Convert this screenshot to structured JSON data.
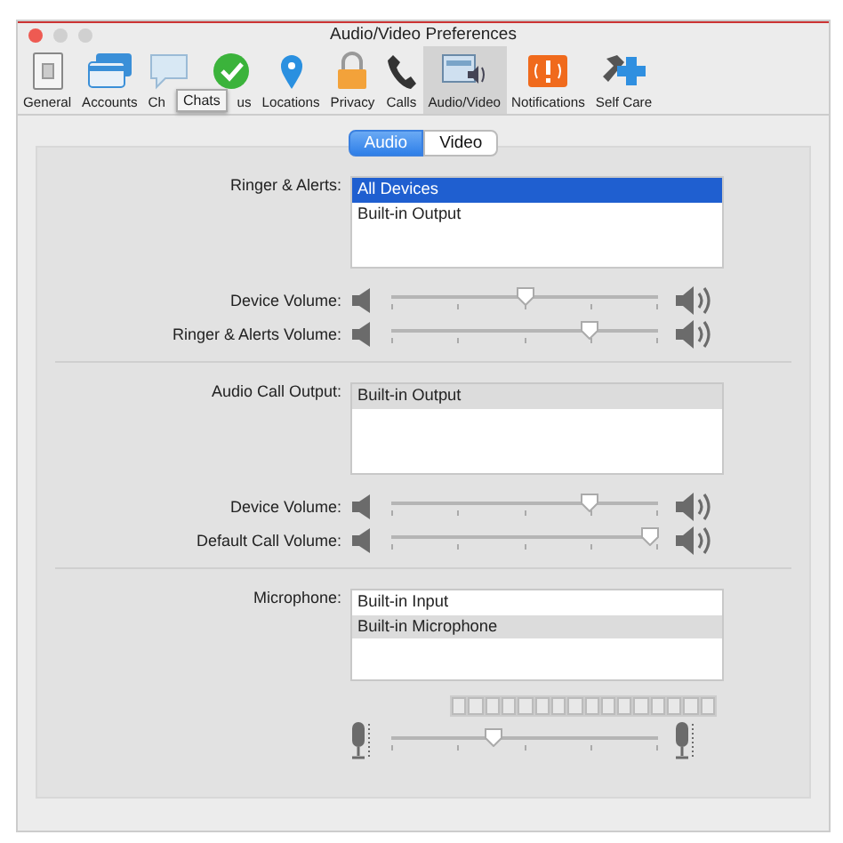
{
  "window": {
    "title": "Audio/Video Preferences"
  },
  "toolbar": [
    {
      "label": "General",
      "selected": false
    },
    {
      "label": "Accounts",
      "selected": false
    },
    {
      "label": "Ch",
      "selected": false
    },
    {
      "label": "us",
      "selected": false
    },
    {
      "label": "Locations",
      "selected": false
    },
    {
      "label": "Privacy",
      "selected": false
    },
    {
      "label": "Calls",
      "selected": false
    },
    {
      "label": "Audio/Video",
      "selected": true
    },
    {
      "label": "Notifications",
      "selected": false
    },
    {
      "label": "Self Care",
      "selected": false
    }
  ],
  "tooltip": "Chats",
  "tabs": [
    {
      "label": "Audio",
      "selected": true
    },
    {
      "label": "Video",
      "selected": false
    }
  ],
  "sections": [
    {
      "label": "Ringer & Alerts:",
      "list": {
        "focused": true,
        "items": [
          {
            "label": "All Devices",
            "selected": true
          },
          {
            "label": "Built-in Output",
            "selected": false
          }
        ]
      },
      "sliders": [
        {
          "kind": "speaker",
          "label": "Device Volume:",
          "level": 0.5
        },
        {
          "kind": "speaker",
          "label": "Ringer & Alerts Volume:",
          "level": 0.74
        }
      ]
    },
    {
      "label": "Audio Call Output:",
      "list": {
        "focused": false,
        "items": [
          {
            "label": "Built-in Output",
            "selected": true
          }
        ]
      },
      "sliders": [
        {
          "kind": "speaker",
          "label": "Device Volume:",
          "level": 0.74
        },
        {
          "kind": "speaker",
          "label": "Default Call Volume:",
          "level": 0.97
        }
      ]
    },
    {
      "label": "Microphone:",
      "list": {
        "focused": false,
        "items": [
          {
            "label": "Built-in Input",
            "selected": false
          },
          {
            "label": "Built-in Microphone",
            "selected": true
          }
        ]
      },
      "meter": {
        "level": 0
      },
      "sliders": [
        {
          "kind": "mic",
          "level": 0.38
        }
      ]
    }
  ]
}
